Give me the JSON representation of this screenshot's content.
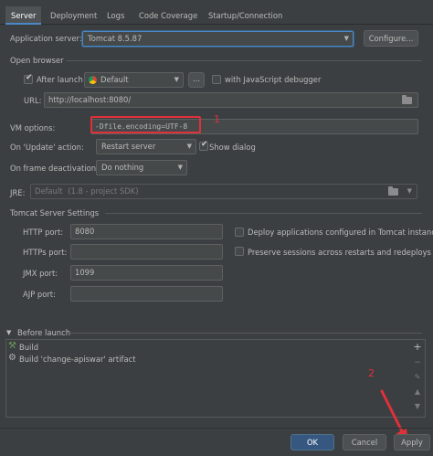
{
  "tabs": [
    "Server",
    "Deployment",
    "Logs",
    "Code Coverage",
    "Startup/Connection"
  ],
  "app_server": {
    "label": "Application server:",
    "value": "Tomcat 8.5.87",
    "configure": "Configure..."
  },
  "open_browser": {
    "section": "Open browser",
    "after_launch": "After launch",
    "browser": "Default",
    "more": "...",
    "js_debugger": "with JavaScript debugger",
    "url_label": "URL:",
    "url": "http://localhost:8080/"
  },
  "vm": {
    "label": "VM options:",
    "value": "-Dfile.encoding=UTF-8"
  },
  "on_update": {
    "label": "On 'Update' action:",
    "value": "Restart server",
    "show_dialog": "Show dialog"
  },
  "on_frame": {
    "label": "On frame deactivation:",
    "value": "Do nothing"
  },
  "jre": {
    "label": "JRE:",
    "value": "Default",
    "hint": "(1.8 - project SDK)"
  },
  "tomcat": {
    "section": "Tomcat Server Settings",
    "http_label": "HTTP port:",
    "http_value": "8080",
    "https_label": "HTTPs port:",
    "https_value": "",
    "jmx_label": "JMX port:",
    "jmx_value": "1099",
    "ajp_label": "AJP port:",
    "ajp_value": "",
    "deploy": "Deploy applications configured in Tomcat instance",
    "preserve": "Preserve sessions across restarts and redeploys"
  },
  "before_launch": {
    "section": "Before launch",
    "items": [
      "Build",
      "Build 'change-apiswar' artifact"
    ],
    "add": "+"
  },
  "annotations": {
    "one": "1",
    "two": "2"
  },
  "footer": {
    "ok": "OK",
    "cancel": "Cancel",
    "apply": "Apply"
  },
  "colors": {
    "background": "#3c3f41",
    "accent": "#4a88c7",
    "annotation": "#e0303a",
    "primary_button": "#365880"
  }
}
